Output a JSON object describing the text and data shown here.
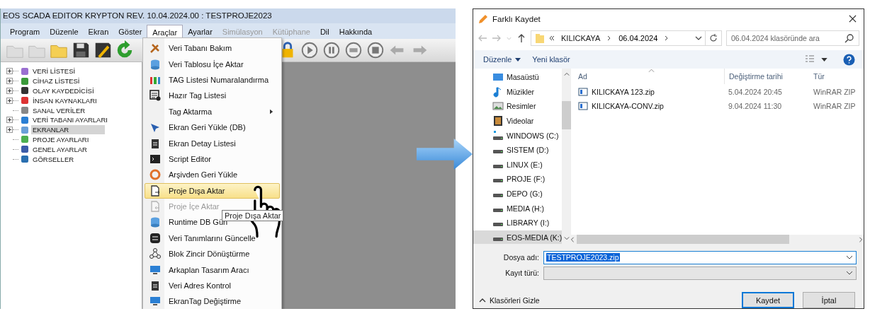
{
  "editor": {
    "title": "EOS SCADA EDITOR KRYPTON REV. 10.04.2024.00 : TESTPROJE2023",
    "menu": [
      {
        "label": "Program",
        "selected": false,
        "disabled": false
      },
      {
        "label": "Düzenle",
        "selected": false,
        "disabled": false
      },
      {
        "label": "Ekran",
        "selected": false,
        "disabled": false
      },
      {
        "label": "Göster",
        "selected": false,
        "disabled": false
      },
      {
        "label": "Araçlar",
        "selected": true,
        "disabled": false
      },
      {
        "label": "Ayarlar",
        "selected": false,
        "disabled": false
      },
      {
        "label": "Simülasyon",
        "selected": false,
        "disabled": true
      },
      {
        "label": "Kütüphane",
        "selected": false,
        "disabled": true
      },
      {
        "label": "Dil",
        "selected": false,
        "disabled": false
      },
      {
        "label": "Hakkında",
        "selected": false,
        "disabled": false
      }
    ],
    "tree": [
      {
        "label": "VERİ LİSTESİ",
        "expandable": true,
        "selected": false
      },
      {
        "label": "CİHAZ LİSTESİ",
        "expandable": true,
        "selected": false
      },
      {
        "label": "OLAY KAYDEDİCİSİ",
        "expandable": true,
        "selected": false
      },
      {
        "label": "İNSAN KAYNAKLARI",
        "expandable": true,
        "selected": false
      },
      {
        "label": "SANAL VERİLER",
        "expandable": false,
        "selected": false
      },
      {
        "label": "VERİ TABANI AYARLARI",
        "expandable": true,
        "selected": false
      },
      {
        "label": "EKRANLAR",
        "expandable": true,
        "selected": true
      },
      {
        "label": "PROJE AYARLARI",
        "expandable": false,
        "selected": false
      },
      {
        "label": "GENEL AYARLAR",
        "expandable": false,
        "selected": false
      },
      {
        "label": "GÖRSELLER",
        "expandable": false,
        "selected": false
      }
    ],
    "dropdown": [
      {
        "label": "Veri Tabanı Bakım",
        "kind": "item",
        "disabled": false,
        "selected": false
      },
      {
        "label": "Veri Tablosu İçe Aktar",
        "kind": "item",
        "disabled": false,
        "selected": false
      },
      {
        "label": "TAG Listesi Numaralandırma",
        "kind": "item",
        "disabled": false,
        "selected": false
      },
      {
        "label": "Hazır Tag Listesi",
        "kind": "item",
        "disabled": false,
        "selected": false
      },
      {
        "label": "Tag Aktarma",
        "kind": "submenu",
        "disabled": false,
        "selected": false
      },
      {
        "label": "Ekran Geri Yükle (DB)",
        "kind": "item",
        "disabled": false,
        "selected": false
      },
      {
        "label": "Ekran Detay Listesi",
        "kind": "item",
        "disabled": false,
        "selected": false
      },
      {
        "label": "Script Editor",
        "kind": "item",
        "disabled": false,
        "selected": false
      },
      {
        "label": "Arşivden Geri Yükle",
        "kind": "item",
        "disabled": false,
        "selected": false
      },
      {
        "label": "Proje Dışa Aktar",
        "kind": "item",
        "disabled": false,
        "selected": true
      },
      {
        "label": "Proje İçe Aktar",
        "kind": "item",
        "disabled": true,
        "selected": false
      },
      {
        "label": "Runtime DB Gün",
        "kind": "item",
        "disabled": false,
        "selected": false
      },
      {
        "label": "Veri Tanımlarını Güncelle",
        "kind": "item",
        "disabled": false,
        "selected": false
      },
      {
        "label": "Blok Zincir Dönüştürme",
        "kind": "item",
        "disabled": false,
        "selected": false
      },
      {
        "label": "Arkaplan Tasarım Aracı",
        "kind": "item",
        "disabled": false,
        "selected": false
      },
      {
        "label": "Veri Adres Kontrol",
        "kind": "item",
        "disabled": false,
        "selected": false
      },
      {
        "label": "EkranTag Değiştirme",
        "kind": "item",
        "disabled": false,
        "selected": false
      }
    ],
    "tooltip": "Proje Dışa Aktar"
  },
  "dialog": {
    "title": "Farklı Kaydet",
    "path": [
      "KILICKAYA",
      "06.04.2024"
    ],
    "search": {
      "placeholder": "06.04.2024 klasöründe ara"
    },
    "toolbar": [
      "Düzenle",
      "Yeni klasör"
    ],
    "nav": [
      {
        "label": "Masaüstü",
        "kind": "desktop",
        "selected": false
      },
      {
        "label": "Müzikler",
        "kind": "music",
        "selected": false
      },
      {
        "label": "Resimler",
        "kind": "pictures",
        "selected": false
      },
      {
        "label": "Videolar",
        "kind": "videos",
        "selected": false
      },
      {
        "label": "WINDOWS (C:)",
        "kind": "system-drive",
        "selected": false
      },
      {
        "label": "SISTEM (D:)",
        "kind": "drive",
        "selected": false
      },
      {
        "label": "LINUX (E:)",
        "kind": "drive",
        "selected": false
      },
      {
        "label": "PROJE (F:)",
        "kind": "drive",
        "selected": false
      },
      {
        "label": "DEPO (G:)",
        "kind": "drive",
        "selected": false
      },
      {
        "label": "MEDIA (H:)",
        "kind": "drive",
        "selected": false
      },
      {
        "label": "LIBRARY (I:)",
        "kind": "drive",
        "selected": false
      },
      {
        "label": "EOS-MEDIA (K:)",
        "kind": "drive",
        "selected": true
      }
    ],
    "columns": [
      "Ad",
      "Değiştirme tarihi",
      "Tür"
    ],
    "files": [
      {
        "name": "KILICKAYA 123.zip",
        "modified": "5.04.2024 20:45",
        "type": "WinRAR ZIP"
      },
      {
        "name": "KILICKAYA-CONV.zip",
        "modified": "9.04.2024 11:30",
        "type": "WinRAR ZIP"
      }
    ],
    "filename_label": "Dosya adı:",
    "filename": "TESTPROJE2023.zip",
    "filetype_label": "Kayıt türü:",
    "hide_folders": "Klasörleri Gizle",
    "buttons": [
      "Kaydet",
      "İptal"
    ]
  }
}
